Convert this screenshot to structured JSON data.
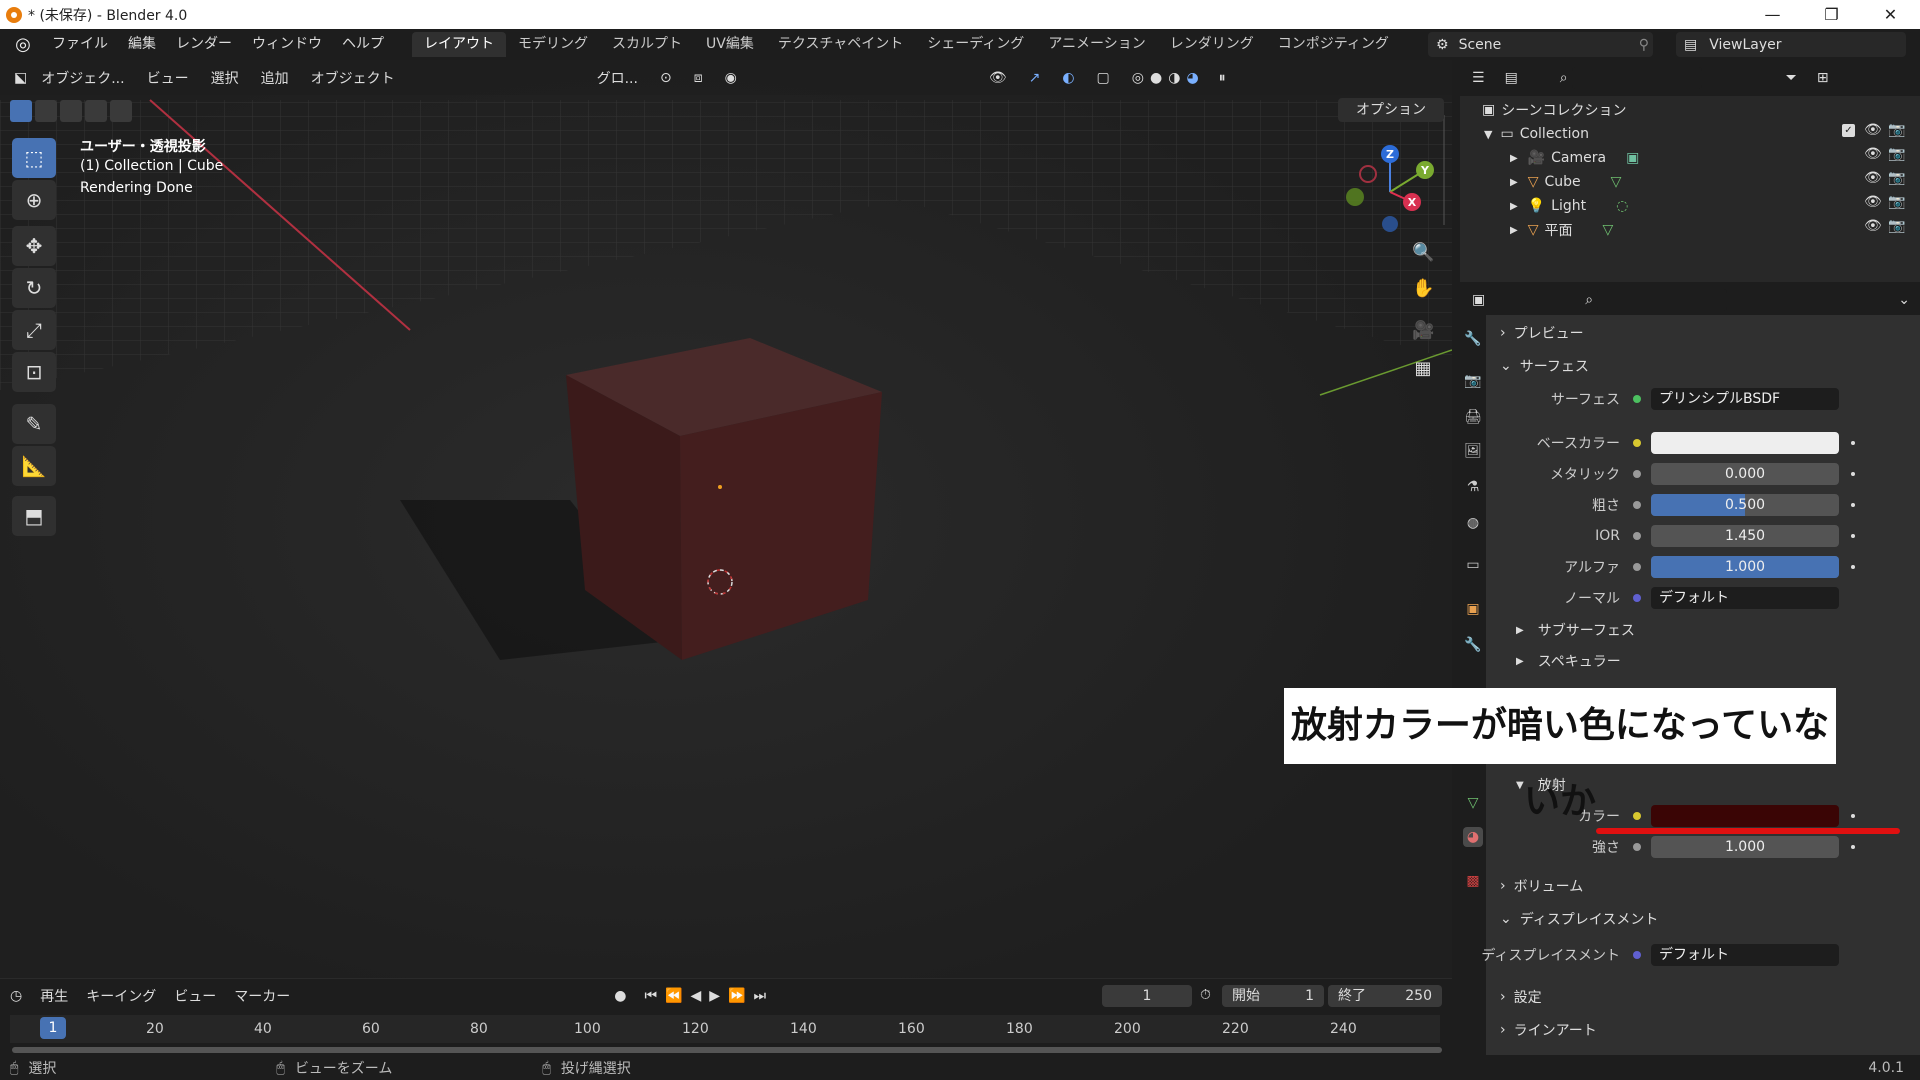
{
  "titlebar": {
    "title": "* (未保存) - Blender 4.0",
    "min": "—",
    "max": "❐",
    "close": "✕"
  },
  "menu": [
    "ファイル",
    "編集",
    "レンダー",
    "ウィンドウ",
    "ヘルプ"
  ],
  "workspaces": [
    "レイアウト",
    "モデリング",
    "スカルプト",
    "UV編集",
    "テクスチャペイント",
    "シェーディング",
    "アニメーション",
    "レンダリング",
    "コンポジティング"
  ],
  "scene": "Scene",
  "viewlayer": "ViewLayer",
  "viewport": {
    "header": {
      "mode": "オブジェク...",
      "view": "ビュー",
      "select": "選択",
      "add": "追加",
      "object": "オブジェクト",
      "transform": "グロ...",
      "options": "オプション"
    },
    "overlay_lines": [
      "ユーザー・透視投影",
      "(1) Collection | Cube",
      "Rendering Done"
    ],
    "gizmo": {
      "z": "Z",
      "y": "Y",
      "x": "X"
    }
  },
  "timeline": {
    "menus": [
      "再生",
      "キーイング",
      "ビュー",
      "マーカー"
    ],
    "current_frame": "1",
    "start_label": "開始",
    "start": "1",
    "end_label": "終了",
    "end": "250",
    "ticks": [
      "20",
      "40",
      "60",
      "80",
      "100",
      "120",
      "140",
      "160",
      "180",
      "200",
      "220",
      "240"
    ],
    "ruler_current": "1"
  },
  "status": {
    "select": "選択",
    "zoom": "ビューをズーム",
    "lasso": "投げ縄選択",
    "version": "4.0.1"
  },
  "outliner": {
    "scene_collection": "シーンコレクション",
    "collection": "Collection",
    "items": [
      "Camera",
      "Cube",
      "Light",
      "平面"
    ]
  },
  "properties": {
    "sections": {
      "preview": "プレビュー",
      "surface": "サーフェス",
      "subsurface": "サブサーフェス",
      "specular": "スペキュラー",
      "emission": "放射",
      "volume": "ボリューム",
      "displacement": "ディスプレイスメント",
      "settings": "設定",
      "lineart": "ラインアート"
    },
    "surface": {
      "label": "サーフェス",
      "value": "プリンシプルBSDF"
    },
    "base_color_label": "ベースカラー",
    "metallic": {
      "label": "メタリック",
      "value": "0.000"
    },
    "roughness": {
      "label": "粗さ",
      "value": "0.500",
      "fraction": 0.5
    },
    "ior": {
      "label": "IOR",
      "value": "1.450"
    },
    "alpha": {
      "label": "アルファ",
      "value": "1.000",
      "fraction": 1.0
    },
    "normal": {
      "label": "ノーマル",
      "value": "デフォルト"
    },
    "emission_color_label": "カラー",
    "emission_color": "#3a0505",
    "strength": {
      "label": "強さ",
      "value": "1.000"
    },
    "displacement": {
      "label": "ディスプレイスメント",
      "value": "デフォルト"
    }
  },
  "annotation": "放射カラーが暗い色になっていないか",
  "colors": {
    "accent": "#4772b3",
    "emission": "#3a0505",
    "highlight": "#e01010"
  }
}
